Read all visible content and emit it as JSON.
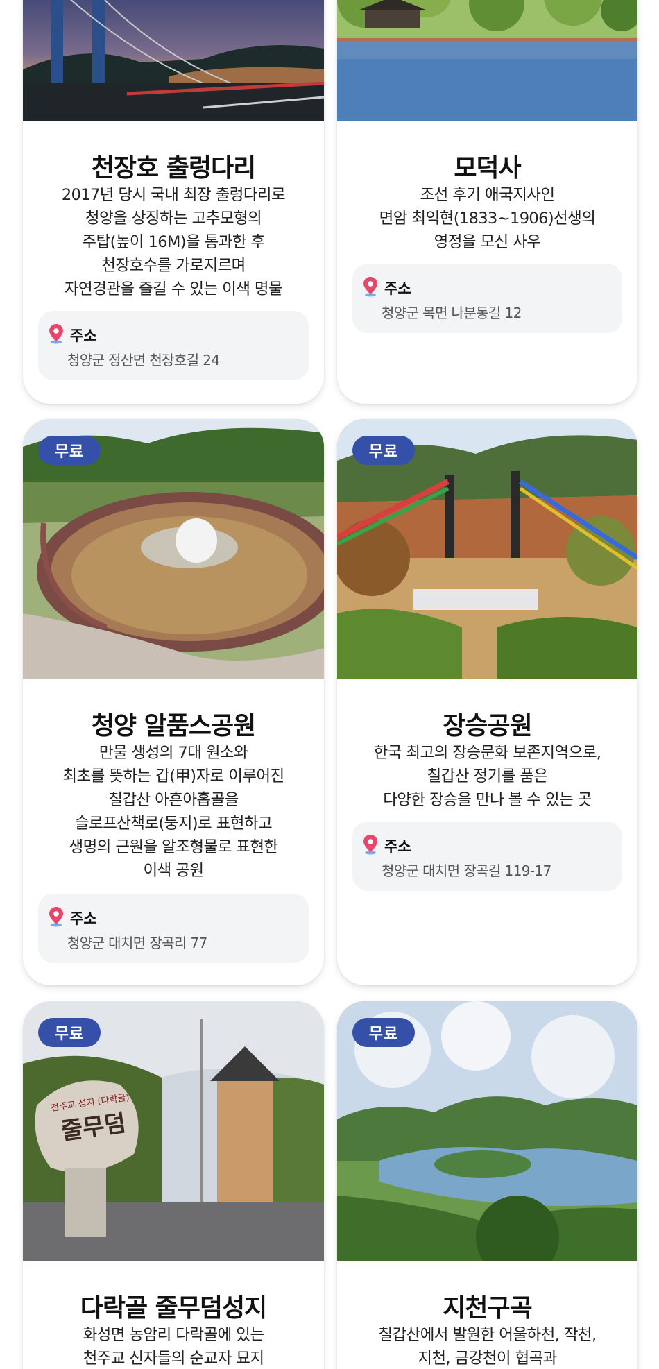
{
  "cards": [
    {
      "title": "천장호 출렁다리",
      "desc": [
        "2017년 당시 국내 최장 출렁다리로",
        "청양을 상징하는 고추모형의",
        "주탑(높이 16M)을 통과한 후",
        "천장호수를 가로지르며",
        "자연경관을 즐길 수 있는 이색 명물"
      ],
      "address_label": "주소",
      "address": "청양군 정산면 천장호길 24"
    },
    {
      "title": "모덕사",
      "desc": [
        "조선 후기 애국지사인",
        "면암 최익현(1833~1906)선생의",
        "영정을 모신 사우"
      ],
      "address_label": "주소",
      "address": "청양군 목면 나분동길 12"
    },
    {
      "badge": "무료",
      "title": "청양 알품스공원",
      "desc": [
        "만물 생성의 7대 원소와",
        "최초를 뜻하는 갑(甲)자로 이루어진",
        "칠갑산 아흔아홉골을",
        "슬로프산책로(둥지)로 표현하고",
        "생명의 근원을 알조형물로 표현한",
        "이색 공원"
      ],
      "address_label": "주소",
      "address": "청양군 대치면 장곡리 77"
    },
    {
      "badge": "무료",
      "title": "장승공원",
      "desc": [
        "한국 최고의 장승문화 보존지역으로,",
        "칠갑산 정기를 품은",
        "다양한 장승을 만나 볼 수 있는 곳"
      ],
      "address_label": "주소",
      "address": "청양군 대치면 장곡길 119-17"
    },
    {
      "badge": "무료",
      "title": "다락골 줄무덤성지",
      "desc": [
        "화성면 농암리 다락골에 있는",
        "천주교 신자들의 순교자 묘지"
      ],
      "sign_text": [
        "천주교 성지 (다락골)",
        "줄무덤"
      ]
    },
    {
      "badge": "무료",
      "title": "지천구곡",
      "desc": [
        "칠갑산에서 발원한 어울하천, 작천,",
        "지천, 금강천이 협곡과"
      ]
    }
  ],
  "icons": {
    "pin": "location-pin-icon"
  },
  "colors": {
    "badge": "#3550a8",
    "pin": "#e8476b",
    "address_bg": "#f3f4f6"
  }
}
